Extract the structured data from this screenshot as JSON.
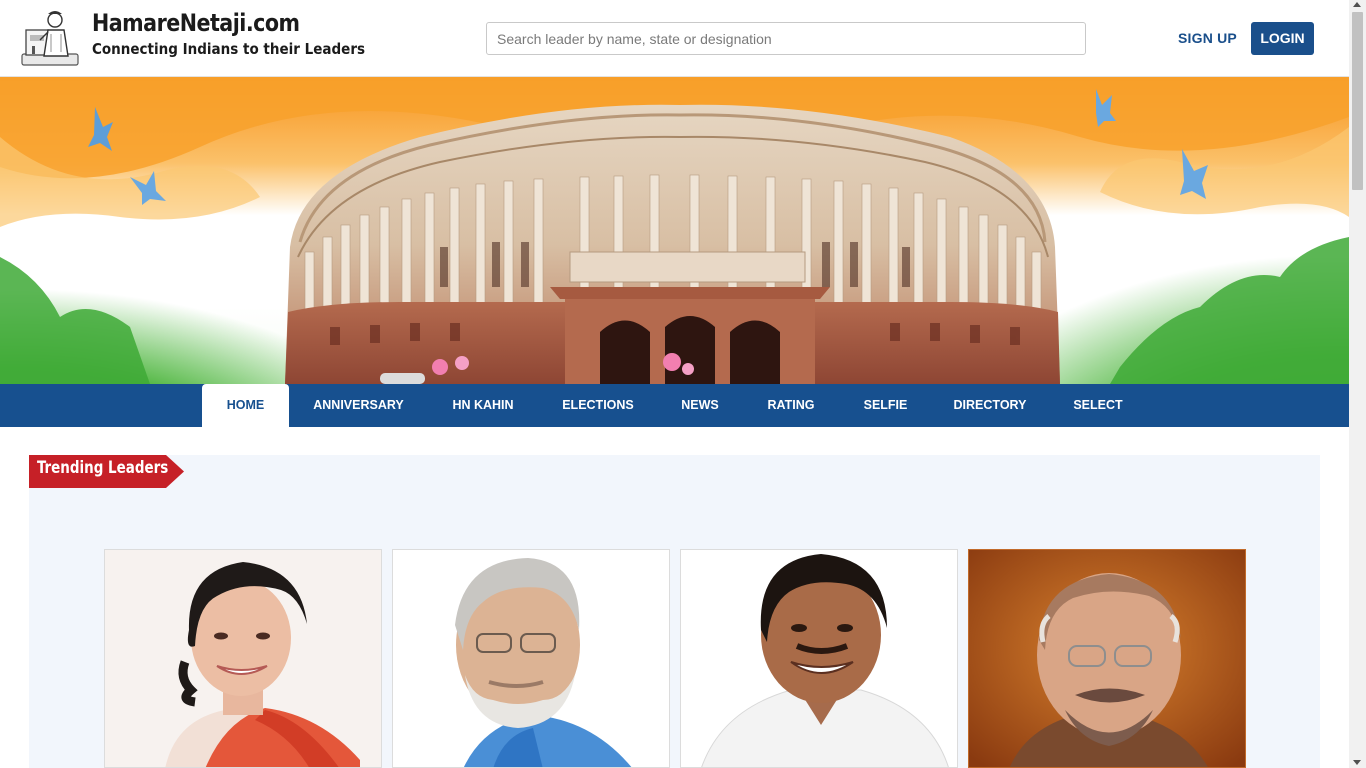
{
  "header": {
    "brand_name": "HamareNetaji.com",
    "tagline": "Connecting Indians to their Leaders",
    "search_placeholder": "Search leader by name, state or designation",
    "search_value": "",
    "signup_label": "SIGN UP",
    "login_label": "LOGIN"
  },
  "nav": {
    "items": [
      {
        "label": "HOME",
        "active": true
      },
      {
        "label": "ANNIVERSARY"
      },
      {
        "label": "HN KAHIN"
      },
      {
        "label": "ELECTIONS"
      },
      {
        "label": "NEWS"
      },
      {
        "label": "RATING"
      },
      {
        "label": "SELFIE"
      },
      {
        "label": "DIRECTORY"
      },
      {
        "label": "SELECT"
      }
    ]
  },
  "trending": {
    "title": "Trending Leaders"
  },
  "colors": {
    "brand_blue": "#17508f",
    "ribbon_red": "#c62027",
    "saffron": "#f7941d",
    "green": "#3aa935",
    "section_bg": "#f2f6fc"
  }
}
